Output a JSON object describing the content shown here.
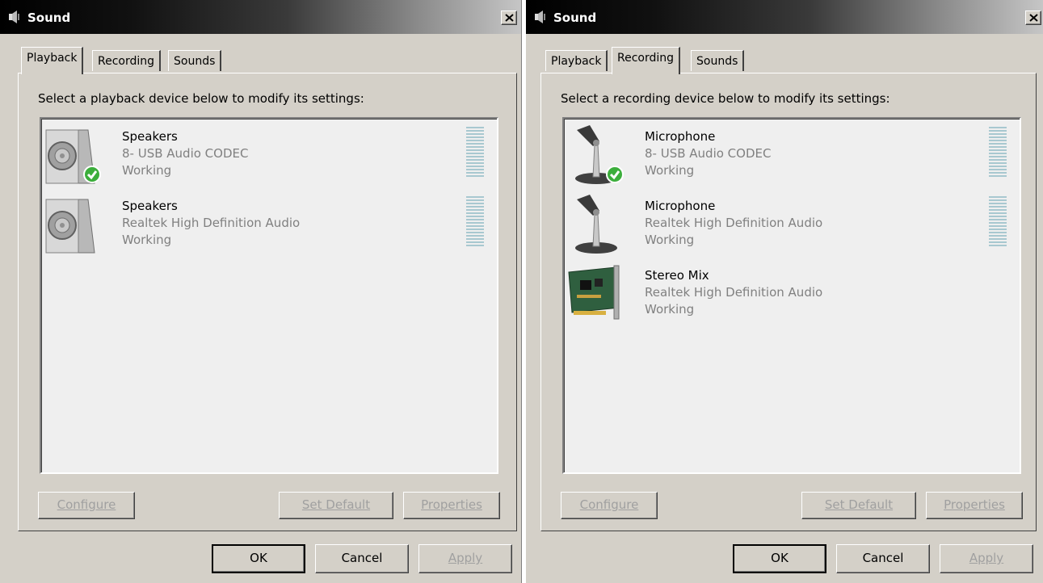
{
  "left": {
    "title": "Sound",
    "tabs": [
      "Playback",
      "Recording",
      "Sounds"
    ],
    "instruction": "Select a playback device below to modify its settings:",
    "devices": [
      {
        "name": "Speakers",
        "driver": "8- USB Audio CODEC",
        "status": "Working",
        "icon": "speaker-icon",
        "default": true
      },
      {
        "name": "Speakers",
        "driver": "Realtek High Definition Audio",
        "status": "Working",
        "icon": "speaker-icon",
        "default": false
      }
    ],
    "buttons": {
      "configure": "Configure",
      "set_default": "Set Default",
      "properties": "Properties"
    },
    "footer": {
      "ok": "OK",
      "cancel": "Cancel",
      "apply": "Apply"
    }
  },
  "right": {
    "title": "Sound",
    "tabs": [
      "Playback",
      "Recording",
      "Sounds"
    ],
    "instruction": "Select a recording device below to modify its settings:",
    "devices": [
      {
        "name": "Microphone",
        "driver": "8- USB Audio CODEC",
        "status": "Working",
        "icon": "microphone-icon",
        "default": true
      },
      {
        "name": "Microphone",
        "driver": "Realtek High Definition Audio",
        "status": "Working",
        "icon": "microphone-icon",
        "default": false
      },
      {
        "name": "Stereo Mix",
        "driver": "Realtek High Definition Audio",
        "status": "Working",
        "icon": "sound-card-icon",
        "default": false
      }
    ],
    "buttons": {
      "configure": "Configure",
      "set_default": "Set Default",
      "properties": "Properties"
    },
    "footer": {
      "ok": "OK",
      "cancel": "Cancel",
      "apply": "Apply"
    }
  },
  "colors": {
    "face": "#d4d0c8",
    "list_bg": "#efefef",
    "meter": "#a8c8d0",
    "disabled_text": "#a0a0a0",
    "default_check": "#3cae3c"
  }
}
